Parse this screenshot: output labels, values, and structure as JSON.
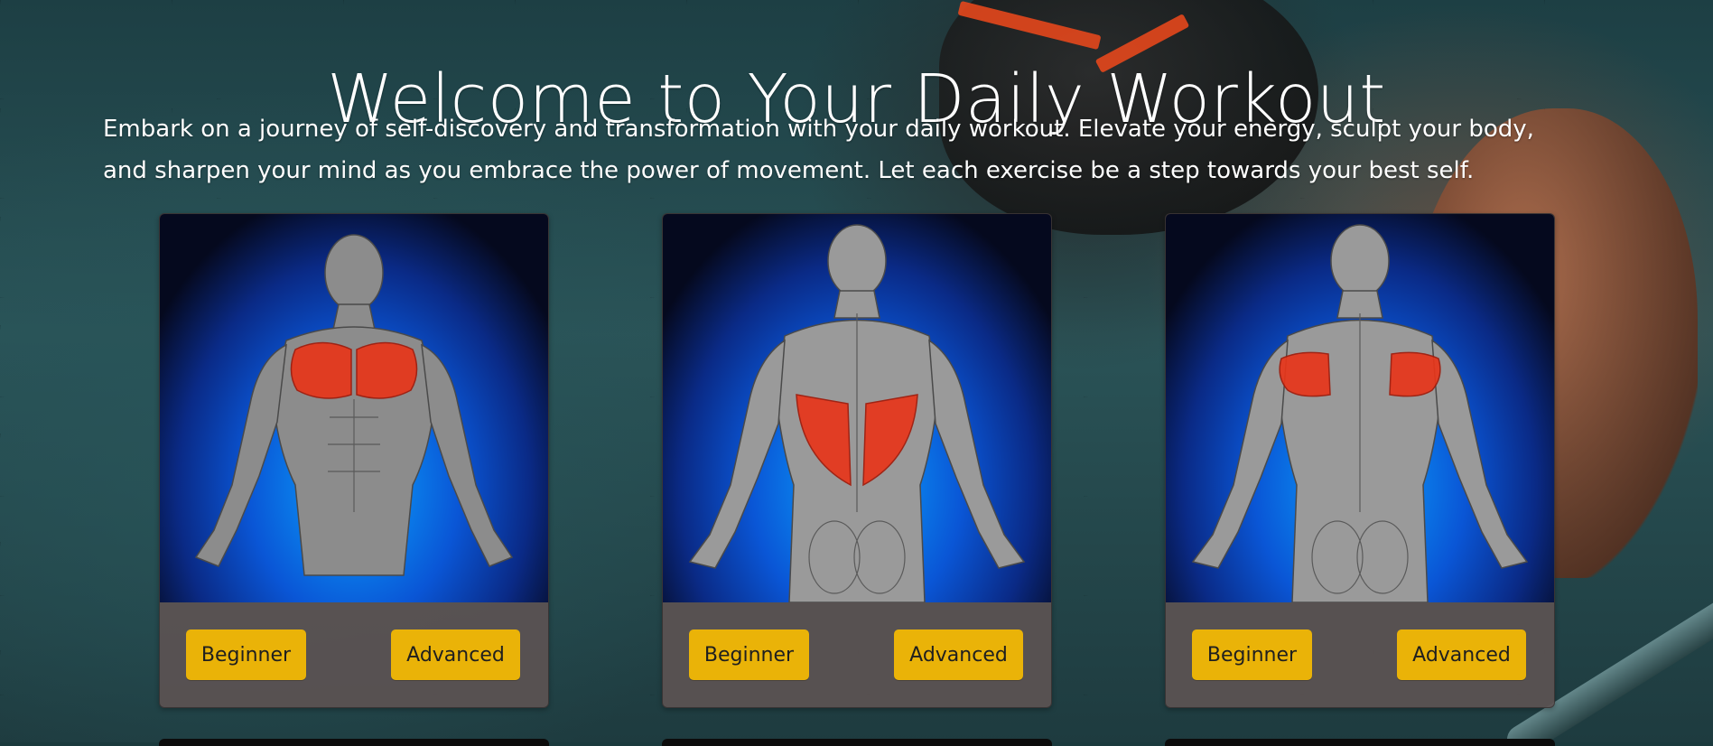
{
  "page": {
    "title": "Welcome to Your Daily Workout",
    "intro": "Embark on a journey of self-discovery and transformation with your daily workout. Elevate your energy, sculpt your body, and sharpen your mind as you embrace the power of movement. Let each exercise be a step towards your best self."
  },
  "cards": [
    {
      "figure": "chest-muscles-figure",
      "beginner_label": "Beginner",
      "advanced_label": "Advanced"
    },
    {
      "figure": "back-lats-muscles-figure",
      "beginner_label": "Beginner",
      "advanced_label": "Advanced"
    },
    {
      "figure": "rear-delts-muscles-figure",
      "beginner_label": "Beginner",
      "advanced_label": "Advanced"
    }
  ],
  "colors": {
    "button_bg": "#eab308",
    "card_bg": "#5c5252",
    "highlight_muscle": "#e8361a",
    "figure_bg": "#0a56d6"
  }
}
